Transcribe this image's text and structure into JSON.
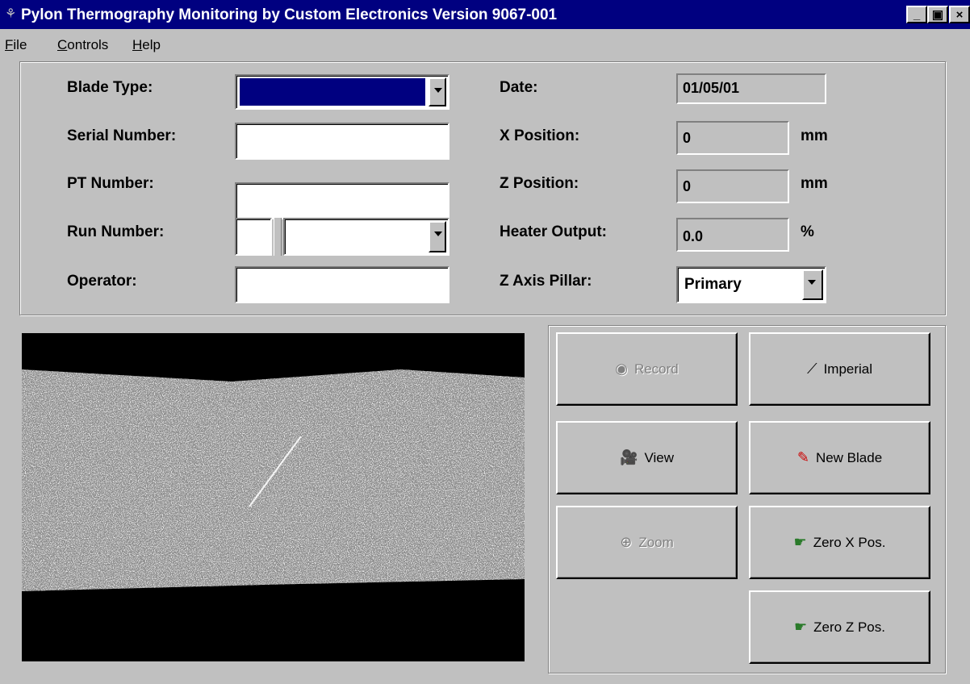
{
  "window": {
    "title": "Pylon Thermography Monitoring by Custom Electronics Version 9067-001",
    "minimize": "_",
    "maximize": "▣",
    "close": "×"
  },
  "menu": {
    "file": "File",
    "controls": "Controls",
    "help": "Help"
  },
  "form": {
    "blade_type_label": "Blade Type:",
    "serial_label": "Serial Number:",
    "pt_label": "PT Number:",
    "run_label": "Run Number:",
    "operator_label": "Operator:",
    "date_label": "Date:",
    "date_value": "01/05/01",
    "x_label": "X Position:",
    "x_value": "0",
    "x_unit": "mm",
    "z_label": "Z Position:",
    "z_value": "0",
    "z_unit": "mm",
    "heater_label": "Heater Output:",
    "heater_value": "0.0",
    "heater_unit": "%",
    "pillar_label": "Z Axis Pillar:",
    "pillar_value": "Primary",
    "blade_type_selected_color": "#000080"
  },
  "buttons": {
    "record": "Record",
    "imperial": "Imperial",
    "view": "View",
    "new_blade": "New Blade",
    "zoom": "Zoom",
    "zero_x": "Zero X Pos.",
    "zero_z": "Zero Z Pos."
  },
  "colors": {
    "titlebar": "#000080",
    "face": "#c0c0c0",
    "image_bg": "#000000",
    "speckle": "#9a9a9a"
  }
}
